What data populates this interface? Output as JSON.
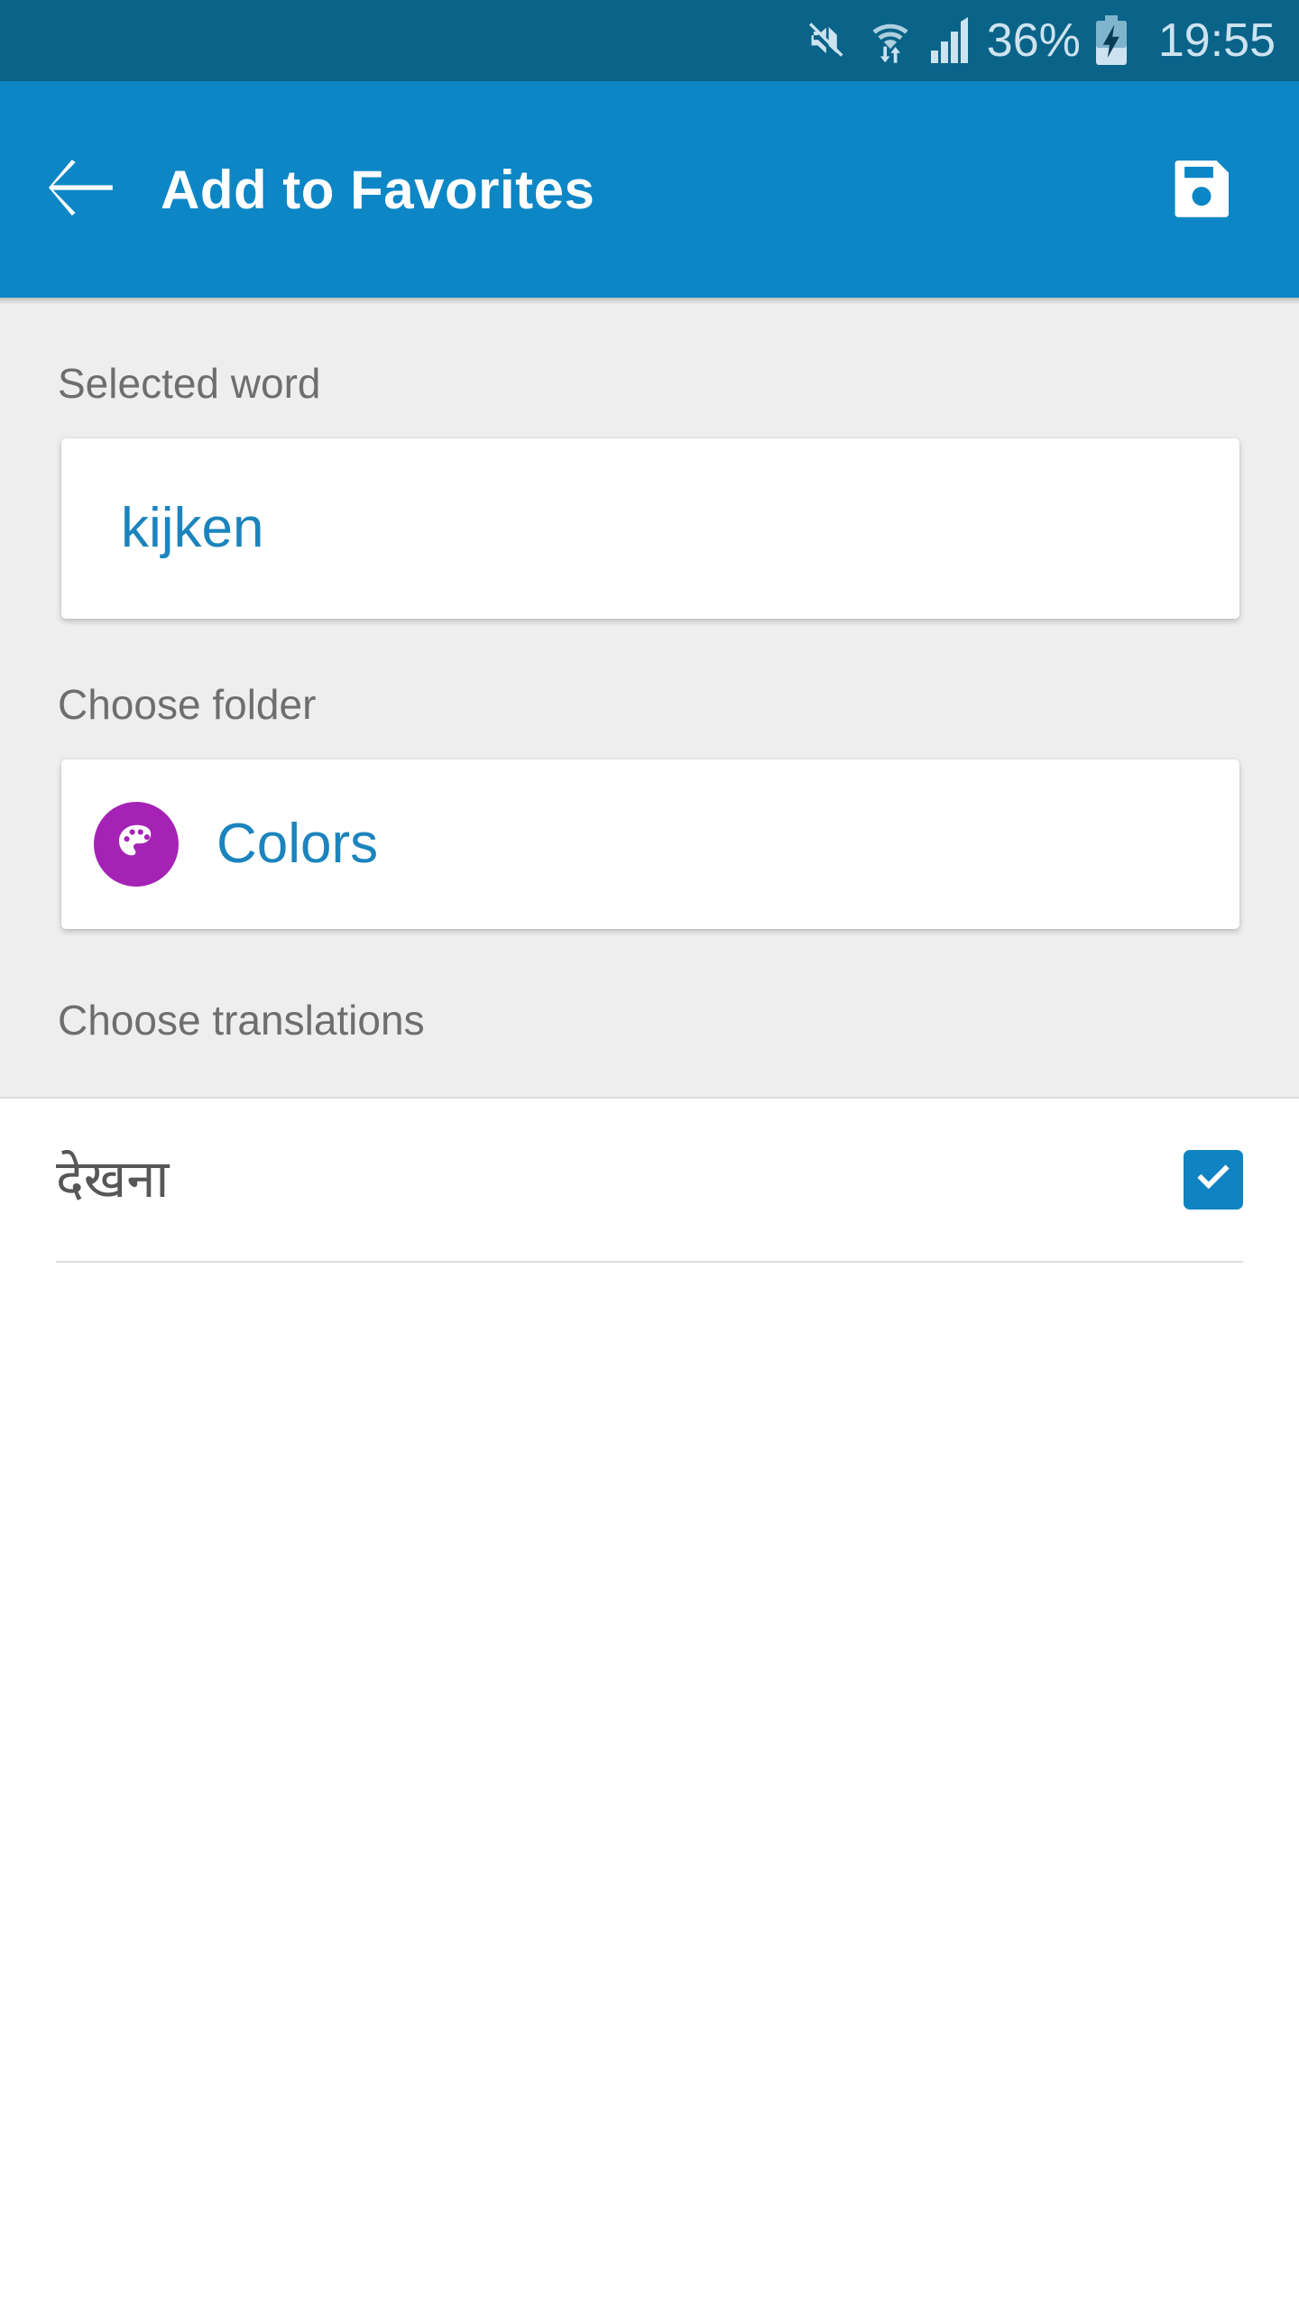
{
  "status_bar": {
    "icons": [
      "mute-icon",
      "wifi-transfer-icon",
      "cellular-signal-icon"
    ],
    "battery_percent": "36%",
    "battery_icon": "battery-charging-icon",
    "time": "19:55",
    "background_color": "#0a6389",
    "foreground_color": "#cde3ef"
  },
  "app_bar": {
    "back_icon": "arrow-left-icon",
    "title": "Add to Favorites",
    "save_icon": "save-floppy-icon",
    "background_color": "#0d86c6",
    "text_color": "#ffffff"
  },
  "main": {
    "selected_word": {
      "label": "Selected word",
      "value": "kijken",
      "value_color": "#1c84bd"
    },
    "choose_folder": {
      "label": "Choose folder",
      "folder_name": "Colors",
      "folder_icon": "palette-icon",
      "folder_avatar_color": "#a423b5",
      "name_color": "#1c84bd"
    },
    "choose_translations": {
      "label": "Choose translations",
      "items": [
        {
          "text": "देखना",
          "checked": true,
          "checkbox_color": "#1083c2"
        }
      ]
    },
    "background_color": "#eeeeee",
    "label_color": "#6e6e6e"
  }
}
